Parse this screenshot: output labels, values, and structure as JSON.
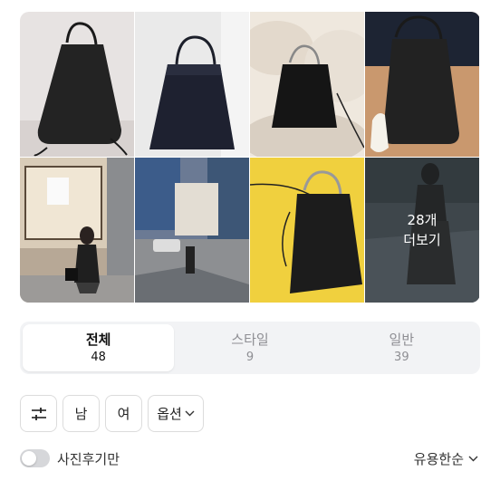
{
  "gallery": {
    "photos": [
      {
        "name": "bag-photo-1"
      },
      {
        "name": "bag-photo-2"
      },
      {
        "name": "bag-photo-3"
      },
      {
        "name": "bag-photo-4"
      },
      {
        "name": "bag-photo-5"
      },
      {
        "name": "bag-photo-6"
      },
      {
        "name": "bag-photo-7"
      }
    ],
    "more": {
      "count_label": "28개",
      "action_label": "더보기"
    }
  },
  "tabs": [
    {
      "label": "전체",
      "count": "48",
      "active": true
    },
    {
      "label": "스타일",
      "count": "9",
      "active": false
    },
    {
      "label": "일반",
      "count": "39",
      "active": false
    }
  ],
  "filters": {
    "settings_icon": "sliders-icon",
    "male_label": "남",
    "female_label": "여",
    "options_label": "옵션",
    "options_icon": "chevron-down-icon"
  },
  "photo_only": {
    "label": "사진후기만",
    "enabled": false
  },
  "sort": {
    "label": "유용한순",
    "icon": "chevron-down-icon"
  }
}
